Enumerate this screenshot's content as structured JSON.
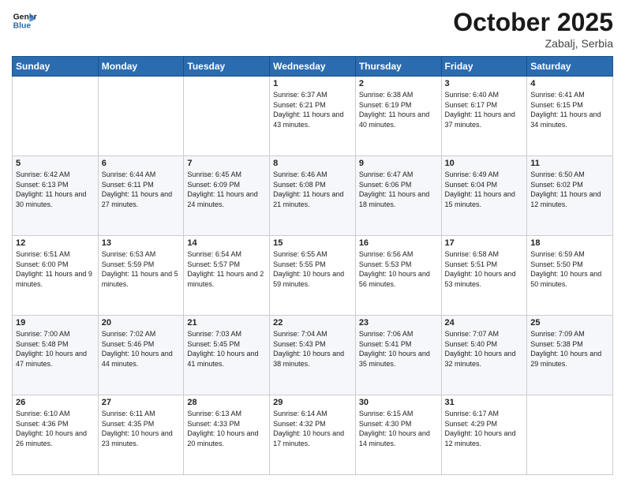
{
  "logo": {
    "text_general": "General",
    "text_blue": "Blue"
  },
  "title": "October 2025",
  "location": "Zabalj, Serbia",
  "days_of_week": [
    "Sunday",
    "Monday",
    "Tuesday",
    "Wednesday",
    "Thursday",
    "Friday",
    "Saturday"
  ],
  "weeks": [
    [
      {
        "day": "",
        "sunrise": "",
        "sunset": "",
        "daylight": ""
      },
      {
        "day": "",
        "sunrise": "",
        "sunset": "",
        "daylight": ""
      },
      {
        "day": "",
        "sunrise": "",
        "sunset": "",
        "daylight": ""
      },
      {
        "day": "1",
        "sunrise": "Sunrise: 6:37 AM",
        "sunset": "Sunset: 6:21 PM",
        "daylight": "Daylight: 11 hours and 43 minutes."
      },
      {
        "day": "2",
        "sunrise": "Sunrise: 6:38 AM",
        "sunset": "Sunset: 6:19 PM",
        "daylight": "Daylight: 11 hours and 40 minutes."
      },
      {
        "day": "3",
        "sunrise": "Sunrise: 6:40 AM",
        "sunset": "Sunset: 6:17 PM",
        "daylight": "Daylight: 11 hours and 37 minutes."
      },
      {
        "day": "4",
        "sunrise": "Sunrise: 6:41 AM",
        "sunset": "Sunset: 6:15 PM",
        "daylight": "Daylight: 11 hours and 34 minutes."
      }
    ],
    [
      {
        "day": "5",
        "sunrise": "Sunrise: 6:42 AM",
        "sunset": "Sunset: 6:13 PM",
        "daylight": "Daylight: 11 hours and 30 minutes."
      },
      {
        "day": "6",
        "sunrise": "Sunrise: 6:44 AM",
        "sunset": "Sunset: 6:11 PM",
        "daylight": "Daylight: 11 hours and 27 minutes."
      },
      {
        "day": "7",
        "sunrise": "Sunrise: 6:45 AM",
        "sunset": "Sunset: 6:09 PM",
        "daylight": "Daylight: 11 hours and 24 minutes."
      },
      {
        "day": "8",
        "sunrise": "Sunrise: 6:46 AM",
        "sunset": "Sunset: 6:08 PM",
        "daylight": "Daylight: 11 hours and 21 minutes."
      },
      {
        "day": "9",
        "sunrise": "Sunrise: 6:47 AM",
        "sunset": "Sunset: 6:06 PM",
        "daylight": "Daylight: 11 hours and 18 minutes."
      },
      {
        "day": "10",
        "sunrise": "Sunrise: 6:49 AM",
        "sunset": "Sunset: 6:04 PM",
        "daylight": "Daylight: 11 hours and 15 minutes."
      },
      {
        "day": "11",
        "sunrise": "Sunrise: 6:50 AM",
        "sunset": "Sunset: 6:02 PM",
        "daylight": "Daylight: 11 hours and 12 minutes."
      }
    ],
    [
      {
        "day": "12",
        "sunrise": "Sunrise: 6:51 AM",
        "sunset": "Sunset: 6:00 PM",
        "daylight": "Daylight: 11 hours and 9 minutes."
      },
      {
        "day": "13",
        "sunrise": "Sunrise: 6:53 AM",
        "sunset": "Sunset: 5:59 PM",
        "daylight": "Daylight: 11 hours and 5 minutes."
      },
      {
        "day": "14",
        "sunrise": "Sunrise: 6:54 AM",
        "sunset": "Sunset: 5:57 PM",
        "daylight": "Daylight: 11 hours and 2 minutes."
      },
      {
        "day": "15",
        "sunrise": "Sunrise: 6:55 AM",
        "sunset": "Sunset: 5:55 PM",
        "daylight": "Daylight: 10 hours and 59 minutes."
      },
      {
        "day": "16",
        "sunrise": "Sunrise: 6:56 AM",
        "sunset": "Sunset: 5:53 PM",
        "daylight": "Daylight: 10 hours and 56 minutes."
      },
      {
        "day": "17",
        "sunrise": "Sunrise: 6:58 AM",
        "sunset": "Sunset: 5:51 PM",
        "daylight": "Daylight: 10 hours and 53 minutes."
      },
      {
        "day": "18",
        "sunrise": "Sunrise: 6:59 AM",
        "sunset": "Sunset: 5:50 PM",
        "daylight": "Daylight: 10 hours and 50 minutes."
      }
    ],
    [
      {
        "day": "19",
        "sunrise": "Sunrise: 7:00 AM",
        "sunset": "Sunset: 5:48 PM",
        "daylight": "Daylight: 10 hours and 47 minutes."
      },
      {
        "day": "20",
        "sunrise": "Sunrise: 7:02 AM",
        "sunset": "Sunset: 5:46 PM",
        "daylight": "Daylight: 10 hours and 44 minutes."
      },
      {
        "day": "21",
        "sunrise": "Sunrise: 7:03 AM",
        "sunset": "Sunset: 5:45 PM",
        "daylight": "Daylight: 10 hours and 41 minutes."
      },
      {
        "day": "22",
        "sunrise": "Sunrise: 7:04 AM",
        "sunset": "Sunset: 5:43 PM",
        "daylight": "Daylight: 10 hours and 38 minutes."
      },
      {
        "day": "23",
        "sunrise": "Sunrise: 7:06 AM",
        "sunset": "Sunset: 5:41 PM",
        "daylight": "Daylight: 10 hours and 35 minutes."
      },
      {
        "day": "24",
        "sunrise": "Sunrise: 7:07 AM",
        "sunset": "Sunset: 5:40 PM",
        "daylight": "Daylight: 10 hours and 32 minutes."
      },
      {
        "day": "25",
        "sunrise": "Sunrise: 7:09 AM",
        "sunset": "Sunset: 5:38 PM",
        "daylight": "Daylight: 10 hours and 29 minutes."
      }
    ],
    [
      {
        "day": "26",
        "sunrise": "Sunrise: 6:10 AM",
        "sunset": "Sunset: 4:36 PM",
        "daylight": "Daylight: 10 hours and 26 minutes."
      },
      {
        "day": "27",
        "sunrise": "Sunrise: 6:11 AM",
        "sunset": "Sunset: 4:35 PM",
        "daylight": "Daylight: 10 hours and 23 minutes."
      },
      {
        "day": "28",
        "sunrise": "Sunrise: 6:13 AM",
        "sunset": "Sunset: 4:33 PM",
        "daylight": "Daylight: 10 hours and 20 minutes."
      },
      {
        "day": "29",
        "sunrise": "Sunrise: 6:14 AM",
        "sunset": "Sunset: 4:32 PM",
        "daylight": "Daylight: 10 hours and 17 minutes."
      },
      {
        "day": "30",
        "sunrise": "Sunrise: 6:15 AM",
        "sunset": "Sunset: 4:30 PM",
        "daylight": "Daylight: 10 hours and 14 minutes."
      },
      {
        "day": "31",
        "sunrise": "Sunrise: 6:17 AM",
        "sunset": "Sunset: 4:29 PM",
        "daylight": "Daylight: 10 hours and 12 minutes."
      },
      {
        "day": "",
        "sunrise": "",
        "sunset": "",
        "daylight": ""
      }
    ]
  ]
}
